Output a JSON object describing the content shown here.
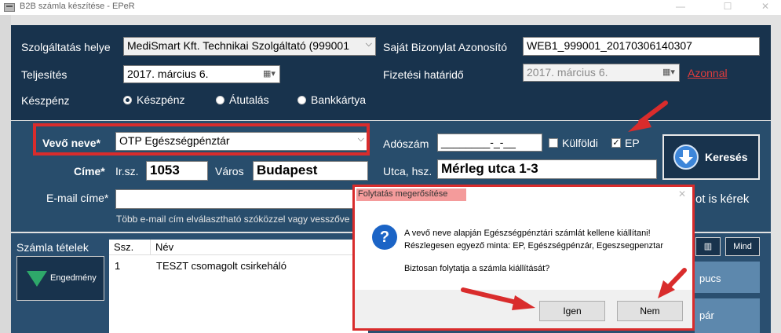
{
  "window": {
    "title": "B2B számla készítése - EPeR"
  },
  "top": {
    "service_label": "Szolgáltatás helye",
    "service_value": "MediSmart Kft. Technikai Szolgáltató (999001",
    "own_id_label": "Saját Bizonylat Azonosító",
    "own_id_value": "WEB1_999001_20170306140307",
    "completion_label": "Teljesítés",
    "completion_date": "2017.   március     6.",
    "due_label": "Fizetési határidő",
    "due_date": "2017.   március     6.",
    "immediate_link": "Azonnal",
    "cash_label": "Készpénz",
    "payment_options": [
      "Készpénz",
      "Átutalás",
      "Bankkártya"
    ]
  },
  "buyer": {
    "name_label": "Vevő neve*",
    "name_value": "OTP Egészségpénztár",
    "tax_label": "Adószám",
    "tax_value": "________-_-__",
    "foreign_label": "Külföldi",
    "ep_label": "EP",
    "ep_checked": "✓",
    "address_label": "Címe*",
    "zip_label": "Ir.sz.",
    "zip_value": "1053",
    "city_label": "Város",
    "city_value": "Budapest",
    "street_label": "Utca, hsz.",
    "street_value": "Mérleg utca 1-3",
    "email_label": "E-mail címe*",
    "email_value": "",
    "email_hint": "Több e-mail cím elválasztható szóközzel vagy vesszőve",
    "copy_text": "ot is kérek",
    "search_button": "Keresés"
  },
  "items": {
    "title": "Számla tételek",
    "discount_button": "Engedmény",
    "columns": [
      "Ssz.",
      "Név"
    ],
    "rows": [
      {
        "ssz": "1",
        "name": "TESZT csomagolt csirkeháló"
      }
    ],
    "all_button": "Mind",
    "side_btn_1": "pucs",
    "side_btn_2": "pár"
  },
  "dialog": {
    "title": "Folytatás megerősítése",
    "line1": "A vevő neve alapján Egészségpénztári számlát kellene kiállítani!",
    "line2": "Részlegesen egyező minta: EP, Egészségpénzár, Egeszsegpenztar",
    "line3": "Biztosan folytatja a számla kiállítását?",
    "yes": "Igen",
    "no": "Nem"
  },
  "colors": {
    "annotation_red": "#d92c2c",
    "panel_dark": "#18334d",
    "panel_mid": "#284d6c",
    "link_red": "#e23c3c"
  }
}
